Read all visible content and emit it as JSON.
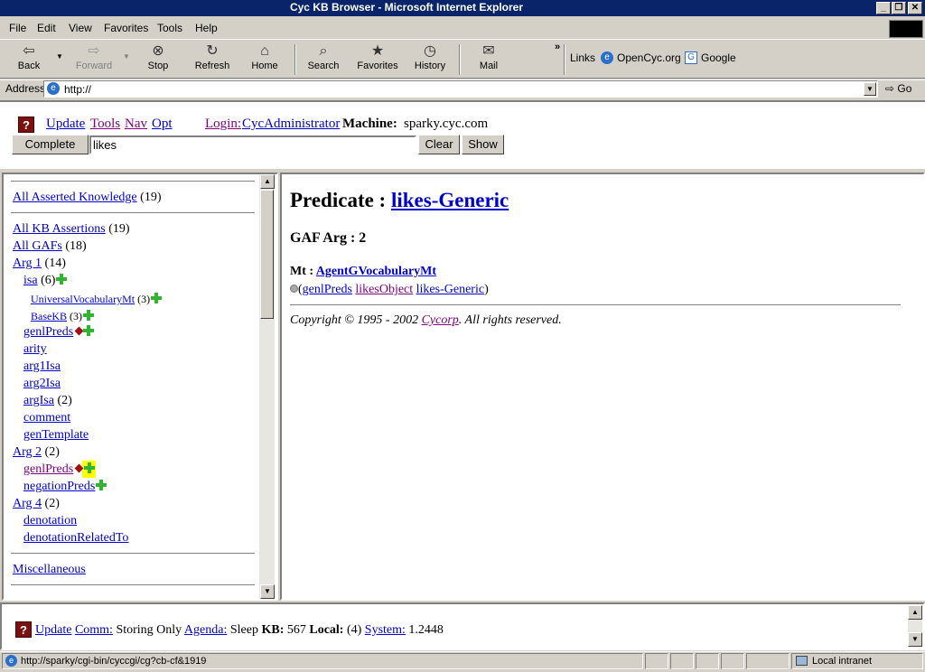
{
  "window": {
    "title": "Cyc KB Browser - Microsoft Internet Explorer"
  },
  "menubar": [
    "File",
    "Edit",
    "View",
    "Favorites",
    "Tools",
    "Help"
  ],
  "toolbar": {
    "back": "Back",
    "forward": "Forward",
    "stop": "Stop",
    "refresh": "Refresh",
    "home": "Home",
    "search": "Search",
    "favorites": "Favorites",
    "history": "History",
    "mail": "Mail"
  },
  "links": {
    "label": "Links",
    "items": [
      "OpenCyc.org",
      "Google"
    ]
  },
  "address": {
    "label": "Address",
    "value": "http://",
    "go": "Go"
  },
  "topframe": {
    "nav": [
      "Update",
      "Tools",
      "Nav",
      "Opt"
    ],
    "login_label": "Login:",
    "user": "CycAdministrator",
    "machine_label": "Machine:",
    "machine": "sparky.cyc.com",
    "complete": "Complete",
    "input_value": "likes",
    "clear": "Clear",
    "show": "Show"
  },
  "leftframe": {
    "all_asserted": {
      "label": "All Asserted Knowledge",
      "count": "(19)"
    },
    "all_kb": {
      "label": "All KB Assertions",
      "count": "(19)"
    },
    "all_gafs": {
      "label": "All GAFs",
      "count": "(18)"
    },
    "arg1": {
      "label": "Arg 1",
      "count": "(14)"
    },
    "isa": {
      "label": "isa",
      "count": "(6)"
    },
    "uvmt": {
      "label": "UniversalVocabularyMt",
      "count": "(3)"
    },
    "basekb": {
      "label": "BaseKB",
      "count": "(3)"
    },
    "genlpreds1": "genlPreds",
    "arity": "arity",
    "arg1isa": "arg1Isa",
    "arg2isa": "arg2Isa",
    "argisa": {
      "label": "argIsa",
      "count": "(2)"
    },
    "comment": "comment",
    "gentemplate": "genTemplate",
    "arg2": {
      "label": "Arg 2",
      "count": "(2)"
    },
    "genlpreds2": "genlPreds",
    "negationpreds": "negationPreds",
    "arg4": {
      "label": "Arg 4",
      "count": "(2)"
    },
    "denotation": "denotation",
    "denotationrelatedto": "denotationRelatedTo",
    "misc": "Miscellaneous"
  },
  "rightframe": {
    "heading_prefix": "Predicate :",
    "heading_link": "likes-Generic",
    "gaf_arg": "GAF Arg : 2",
    "mt_label": "Mt :",
    "mt_link": "AgentGVocabularyMt",
    "assertion": {
      "open": "(",
      "p1": "genlPreds",
      "p2": "likesObject",
      "p3": "likes-Generic",
      "close": ")"
    },
    "copyright_prefix": "Copyright © 1995 - 2002",
    "copyright_link": "Cycorp",
    "copyright_suffix": ". All rights reserved."
  },
  "bottomframe": {
    "update": "Update",
    "comm_label": "Comm:",
    "comm_value": "Storing Only",
    "agenda_label": "Agenda:",
    "agenda_value": "Sleep",
    "kb_label": "KB:",
    "kb_value": "567",
    "local_label": "Local:",
    "local_value": "(4)",
    "system_label": "System:",
    "system_value": "1.2448"
  },
  "statusbar": {
    "url": "http://sparky/cgi-bin/cyccgi/cg?cb-cf&1919",
    "zone": "Local intranet"
  }
}
